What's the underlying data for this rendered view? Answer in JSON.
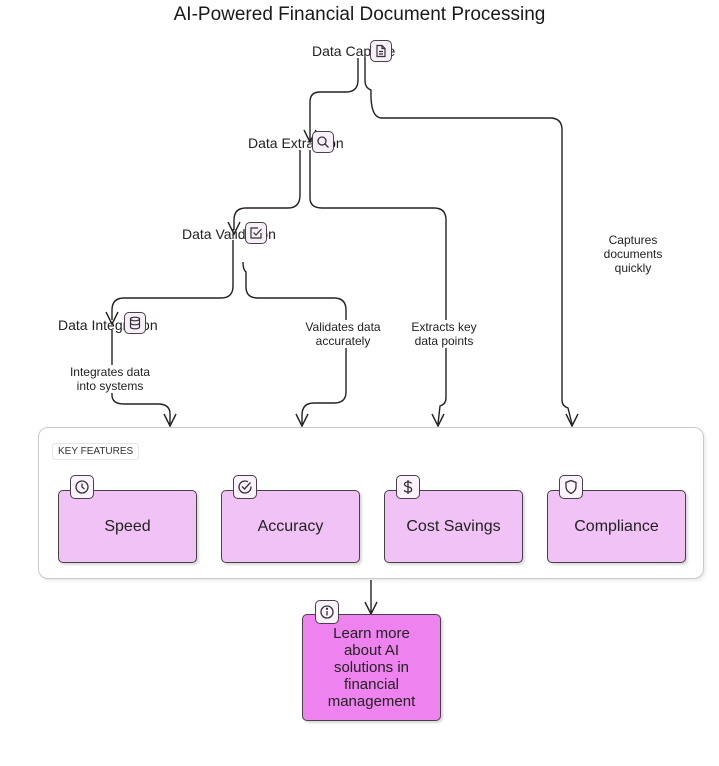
{
  "title": "AI-Powered Financial Document Processing",
  "steps": [
    {
      "label": "Data Capture",
      "icon": "document-icon"
    },
    {
      "label": "Data Extraction",
      "icon": "search-icon"
    },
    {
      "label": "Data Validation",
      "icon": "checkbox-icon"
    },
    {
      "label": "Data Integration",
      "icon": "database-icon"
    }
  ],
  "edge_labels": {
    "capture": "Captures documents quickly",
    "extraction": "Extracts key data points",
    "validation": "Validates data accurately",
    "integration": "Integrates data into systems"
  },
  "group": {
    "label": "KEY FEATURES",
    "features": [
      {
        "label": "Speed",
        "icon": "clock-icon"
      },
      {
        "label": "Accuracy",
        "icon": "check-circle-icon"
      },
      {
        "label": "Cost Savings",
        "icon": "dollar-icon"
      },
      {
        "label": "Compliance",
        "icon": "shield-icon"
      }
    ]
  },
  "cta": {
    "label": "Learn more about AI solutions in financial management",
    "icon": "info-icon"
  },
  "colors": {
    "feature_fill": "#f1c2f5",
    "cta_fill": "#ee82ee",
    "stroke": "#444444"
  }
}
